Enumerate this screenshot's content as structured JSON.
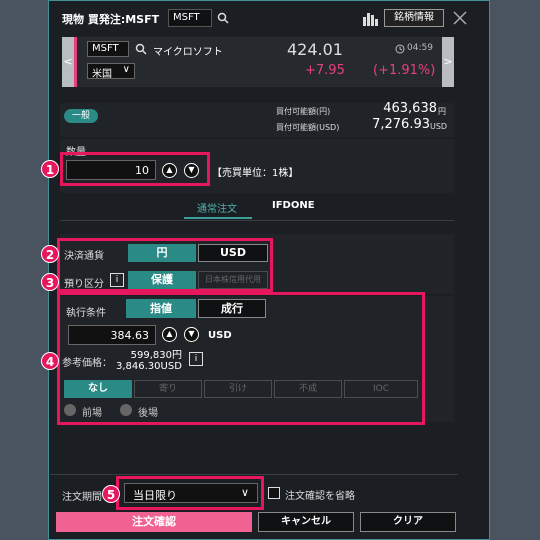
{
  "header": {
    "title": "現物 買発注:MSFT",
    "symbol_input": "MSFT",
    "info_button": "銘柄情報"
  },
  "quote": {
    "symbol": "MSFT",
    "name": "マイクロソフト",
    "market": "米国",
    "price": "424.01",
    "time": "04:59",
    "change": "+7.95",
    "change_pct": "(+1.91%)"
  },
  "account": {
    "tag": "一般",
    "buy_power_jpy_label": "買付可能額(円)",
    "buy_power_jpy": "463,638",
    "buy_power_jpy_unit": "円",
    "buy_power_usd_label": "買付可能額(USD)",
    "buy_power_usd": "7,276.93",
    "buy_power_usd_unit": "USD"
  },
  "quantity": {
    "label": "数量",
    "value": "10",
    "unit_note": "【売買単位：1株】"
  },
  "tabs": [
    {
      "label": "通常注文",
      "active": true
    },
    {
      "label": "IFDONE",
      "active": false
    }
  ],
  "settlement": {
    "label": "決済通貨",
    "options": [
      "円",
      "USD"
    ],
    "selected": "円"
  },
  "deposit": {
    "label": "預り区分",
    "info": "i",
    "options": [
      "保護",
      "日本株信用代用"
    ],
    "selected": "保護"
  },
  "execution": {
    "label": "執行条件",
    "options": [
      "指値",
      "成行"
    ],
    "selected": "指値",
    "price": "384.63",
    "unit": "USD",
    "ref_label": "参考価格：",
    "ref_jpy": "599,830円",
    "ref_usd": "3,846.30USD",
    "info": "i",
    "conditions": [
      "なし",
      "寄り",
      "引け",
      "不成",
      "IOC"
    ],
    "selected_condition": "なし",
    "sessions": [
      "前場",
      "後場"
    ]
  },
  "period": {
    "label": "注文期間",
    "value": "当日限り",
    "skip_confirm_label": "注文確認を省略"
  },
  "actions": {
    "confirm": "注文確認",
    "cancel": "キャンセル",
    "clear": "クリア"
  },
  "markers": [
    "1",
    "2",
    "3",
    "4",
    "5"
  ],
  "colors": {
    "accent": "#2a8a85",
    "highlight": "#e6175d",
    "price_up": "#e8407b",
    "confirm_bg": "#f06292"
  }
}
